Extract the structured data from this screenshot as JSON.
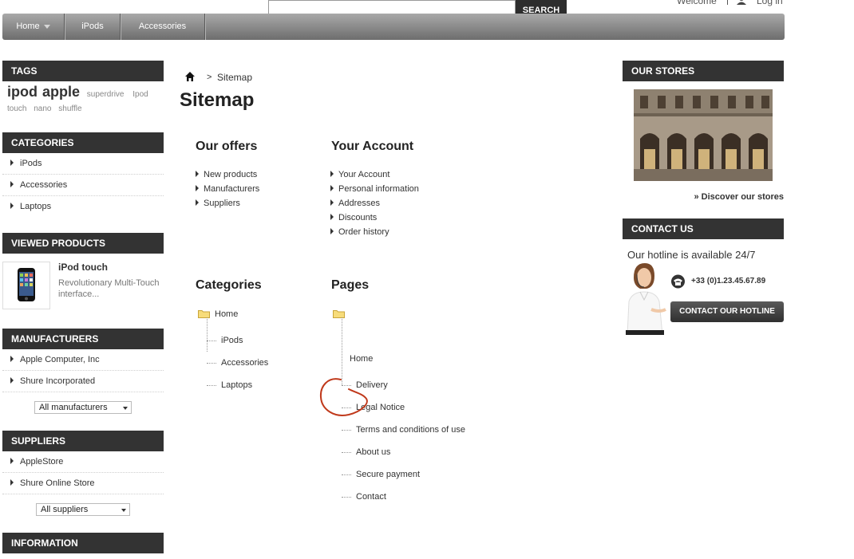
{
  "header": {
    "search_placeholder": "",
    "search_button": "SEARCH",
    "welcome": "Welcome",
    "login": "Log in"
  },
  "topnav": [
    {
      "label": "Home"
    },
    {
      "label": "iPods"
    },
    {
      "label": "Accessories"
    }
  ],
  "tags": {
    "title": "TAGS",
    "big": [
      "ipod",
      "apple"
    ],
    "small": [
      "superdrive",
      "Ipod",
      "touch",
      "nano",
      "shuffle"
    ]
  },
  "categories": {
    "title": "CATEGORIES",
    "items": [
      "iPods",
      "Accessories",
      "Laptops"
    ]
  },
  "viewed": {
    "title": "VIEWED PRODUCTS",
    "product_name": "iPod touch",
    "product_desc": "Revolutionary Multi-Touch interface..."
  },
  "manufacturers": {
    "title": "MANUFACTURERS",
    "items": [
      "Apple Computer, Inc",
      "Shure Incorporated"
    ],
    "select": "All manufacturers"
  },
  "suppliers": {
    "title": "SUPPLIERS",
    "items": [
      "AppleStore",
      "Shure Online Store"
    ],
    "select": "All suppliers"
  },
  "information": {
    "title": "INFORMATION"
  },
  "breadcrumb": {
    "sep": ">",
    "current": "Sitemap"
  },
  "page_title": "Sitemap",
  "our_offers": {
    "title": "Our offers",
    "items": [
      "New products",
      "Manufacturers",
      "Suppliers"
    ]
  },
  "your_account": {
    "title": "Your Account",
    "items": [
      "Your Account",
      "Personal information",
      "Addresses",
      "Discounts",
      "Order history"
    ]
  },
  "categories_tree": {
    "title": "Categories",
    "root": "Home",
    "items": [
      "iPods",
      "Accessories",
      "Laptops"
    ]
  },
  "pages_tree": {
    "title": "Pages",
    "root": "Home",
    "items": [
      "Delivery",
      "Legal Notice",
      "Terms and conditions of use",
      "About us",
      "Secure payment",
      "Contact"
    ]
  },
  "stores": {
    "title": "OUR STORES",
    "discover": "» Discover our stores"
  },
  "contact": {
    "title": "CONTACT US",
    "hotline_text": "Our hotline is available 24/7",
    "phone": "+33 (0)1.23.45.67.89",
    "button": "CONTACT OUR HOTLINE"
  }
}
